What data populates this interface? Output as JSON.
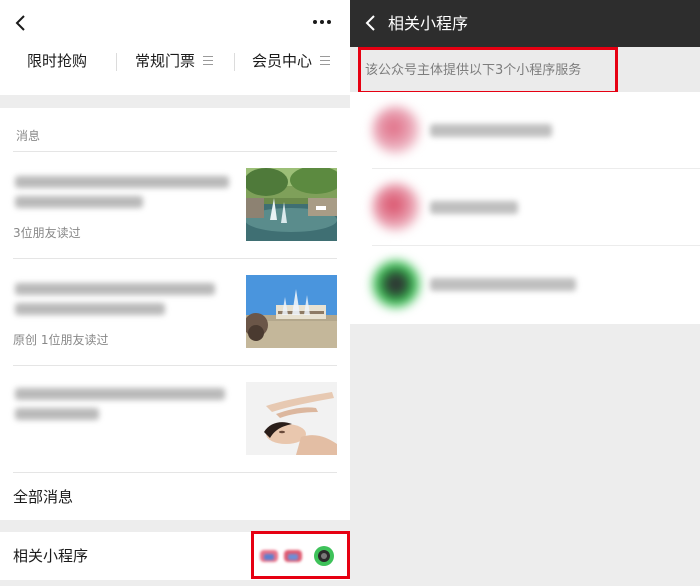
{
  "left_panel": {
    "menu": [
      {
        "label": "限时抢购"
      },
      {
        "label": "常规门票"
      },
      {
        "label": "会员中心"
      }
    ],
    "messages_title": "消息",
    "articles": [
      {
        "read_text": "3位朋友读过",
        "image": "hot-spring-fountain-photo"
      },
      {
        "read_text": "原创 1位朋友读过",
        "image": "water-park-fountain-photo"
      },
      {
        "read_text": "",
        "image": "spa-massage-photo"
      }
    ],
    "all_messages_label": "全部消息",
    "related_miniprograms_label": "相关小程序"
  },
  "right_panel": {
    "title": "相关小程序",
    "info_text": "该公众号主体提供以下3个小程序服务",
    "items_count": 3
  },
  "colors": {
    "header_dark": "#2d2d2d",
    "highlight_red": "#e60012",
    "background_gray": "#ededed"
  }
}
